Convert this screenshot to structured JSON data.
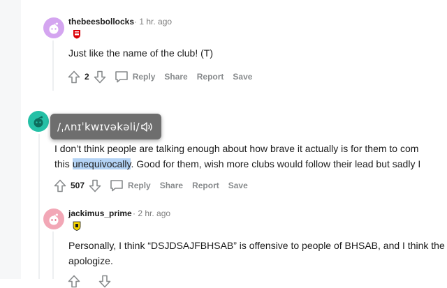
{
  "comments": [
    {
      "username": "thebeesbollocks",
      "timestamp": "· 1 hr. ago",
      "flair_icon": "arsenal-crest-icon",
      "body_lines": [
        "Just like the name of the club! (T)"
      ],
      "votes": "2",
      "actions": [
        "Reply",
        "Share",
        "Report",
        "Save"
      ],
      "avatar_color": "#d4a5f0"
    },
    {
      "username": "",
      "timestamp": "",
      "body_line1": "I don’t think people are talking enough about how brave it actually is for them to com",
      "body_line2_before": "this ",
      "body_line2_highlight": "unequivocally",
      "body_line2_after": ". Good for them, wish more clubs would follow their lead but sadly I",
      "votes": "507",
      "actions": [
        "Reply",
        "Share",
        "Report",
        "Save"
      ],
      "avatar_color": "#24c0a6"
    },
    {
      "username": "jackimus_prime",
      "timestamp": "· 2 hr. ago",
      "flair_icon": "yellow-crest-icon",
      "body_lines": [
        "Personally, I think “DSJDSAJFBHSAB” is offensive to people of BHSAB, and I think the",
        "apologize."
      ],
      "avatar_color": "#f2a7b6"
    }
  ],
  "tooltip": {
    "pronunciation": "/ˌʌnɪˈkwɪvəkəli/",
    "icon": "speaker-icon"
  },
  "colors": {
    "highlight": "#b4d3f5",
    "tooltip_bg": "#6e6e6e",
    "meta_gray": "#878a8c"
  }
}
